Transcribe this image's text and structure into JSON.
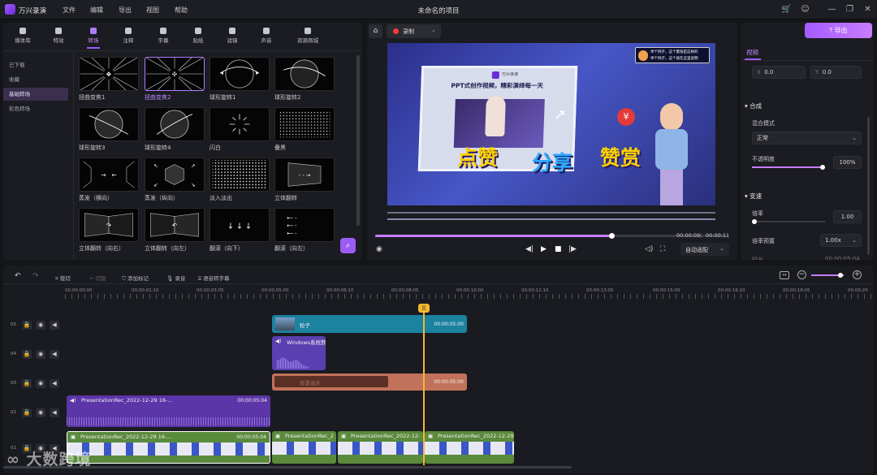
{
  "app": {
    "name": "万兴录演",
    "window_title": "未命名的项目"
  },
  "menu": [
    "文件",
    "编辑",
    "导出",
    "视图",
    "帮助"
  ],
  "categories": [
    {
      "label": "媒体库",
      "icon": "layers-icon"
    },
    {
      "label": "特效",
      "icon": "sparkle-icon"
    },
    {
      "label": "转场",
      "icon": "transition-icon"
    },
    {
      "label": "注释",
      "icon": "comment-icon"
    },
    {
      "label": "字幕",
      "icon": "text-icon"
    },
    {
      "label": "贴纸",
      "icon": "sticker-icon"
    },
    {
      "label": "滤镜",
      "icon": "filter-icon"
    },
    {
      "label": "声音",
      "icon": "music-icon"
    },
    {
      "label": "资源商城",
      "icon": "store-icon"
    }
  ],
  "sidebar": [
    "已下载",
    "收藏",
    "基础转场",
    "彩色转场"
  ],
  "tiles": [
    "扭曲变焦1",
    "扭曲变焦2",
    "球形旋转1",
    "球形旋转2",
    "球形旋转3",
    "球形旋转4",
    "闪白",
    "叠黑",
    "蒸发（横向）",
    "蒸发（纵向）",
    "淡入淡出",
    "立体翻转",
    "立体翻转（向右）",
    "立体翻转（向左）",
    "翻滚（向下）",
    "翻滚（向左）"
  ],
  "preview": {
    "record_label": "录制",
    "time_current": "00:00:09",
    "time_total": "00:00:11",
    "fit_label": "自动适配",
    "progress": 0.67,
    "slide_title": "PPT式创作视频，精彩演绎每一天",
    "slide_logo": "万兴录演",
    "big_words": [
      "点赞",
      "分享",
      "赞赏"
    ],
    "chat_lines": [
      "举个例子，这个量值是这样的",
      "举个例子，这个值在这里说明"
    ]
  },
  "export_label": "导出",
  "right": {
    "tab": "视频",
    "x_label": "X",
    "x_value": "0.0",
    "y_label": "Y",
    "y_value": "0.0",
    "composite_title": "合成",
    "blend_label": "混合模式",
    "blend_value": "正常",
    "opacity_label": "不透明度",
    "opacity_value": "100%",
    "opacity": 1.0,
    "speed_title": "变速",
    "rate_label": "倍率",
    "rate_value": "1.00",
    "rate_preset_label": "倍率预置",
    "rate_preset_value": "1.00x",
    "cut_label": "时长",
    "cut_value": "00:00:05:04"
  },
  "timeline": {
    "tools": [
      "裁切",
      "切割",
      "添加标记",
      "录音",
      "语音转字幕"
    ],
    "ruler": [
      "00:00:00:00",
      "00:00:01:10",
      "00:00:03:05",
      "00:00:05:00",
      "00:00:06:10",
      "00:00:08:05",
      "00:00:10:00",
      "00:00:11:10",
      "00:00:13:05",
      "00:00:15:00",
      "00:00:16:10",
      "00:00:18:05",
      "00:00:20"
    ],
    "tracks": [
      "05",
      "04",
      "03",
      "02",
      "01"
    ],
    "clips": {
      "c05": {
        "name": "粒子",
        "dur": "00:00:05:00"
      },
      "c04": {
        "name": "Windows系统默"
      },
      "c03": {
        "name": "背景音乐",
        "dur": "00:00:05:00"
      },
      "c02": {
        "name": "PresentationRec_2022-12-29 16-...",
        "dur": "00:00:05:04"
      },
      "c01a": {
        "name": "PresentationRec_2022-12-29 16-...",
        "dur": "00:00:05:04"
      },
      "c01b": {
        "name": "PresentationRec_2"
      },
      "c01c": {
        "name": "PresentationRec_2022-12-"
      },
      "c01d": {
        "name": "PresentationRec_2022-12-29"
      }
    }
  },
  "watermark": "大数跨境"
}
